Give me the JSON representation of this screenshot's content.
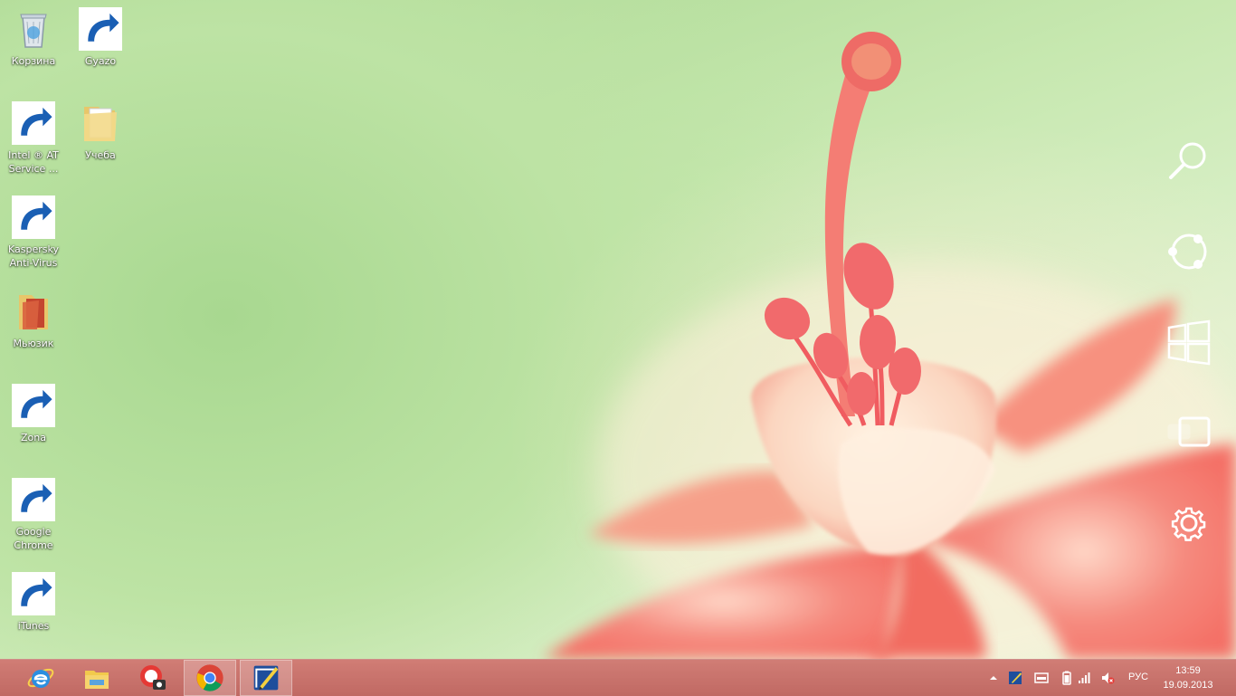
{
  "desktop": {
    "icons": [
      {
        "label": "Корзина",
        "icon": "recycle-bin-icon",
        "shortcut": false
      },
      {
        "label": "Gyazo",
        "icon": "gyazo-icon",
        "shortcut": true
      },
      {
        "label": "Intel ® AT Service ...",
        "icon": "intel-at-icon",
        "shortcut": true
      },
      {
        "label": "Учеба",
        "icon": "folder-icon",
        "shortcut": false
      },
      {
        "label": "Kaspersky Anti-Virus",
        "icon": "kaspersky-icon",
        "shortcut": true
      },
      {
        "label": "Мьюзик",
        "icon": "folder-music-icon",
        "shortcut": false
      },
      {
        "label": "Zona",
        "icon": "zona-icon",
        "shortcut": true
      },
      {
        "label": "Google Chrome",
        "icon": "chrome-icon",
        "shortcut": true
      },
      {
        "label": "iTunes",
        "icon": "itunes-icon",
        "shortcut": true
      }
    ]
  },
  "charms": [
    {
      "name": "search",
      "icon": "search-icon"
    },
    {
      "name": "share",
      "icon": "share-icon"
    },
    {
      "name": "start",
      "icon": "windows-start-icon"
    },
    {
      "name": "devices",
      "icon": "devices-icon"
    },
    {
      "name": "settings",
      "icon": "gear-icon"
    }
  ],
  "taskbar": {
    "pinned": [
      {
        "app": "Internet Explorer",
        "icon": "ie-icon",
        "active": false
      },
      {
        "app": "File Explorer",
        "icon": "file-explorer-icon",
        "active": false
      },
      {
        "app": "Gyazo screenshot",
        "icon": "screenshot-app-icon",
        "active": false
      },
      {
        "app": "Google Chrome",
        "icon": "chrome-icon",
        "active": true
      },
      {
        "app": "Gyazo",
        "icon": "gyazo-icon",
        "active": true
      }
    ],
    "tray": {
      "icons": [
        "show-hidden-icons-icon",
        "gyazo-tray-icon",
        "display-icon",
        "battery-icon",
        "network-signal-icon",
        "volume-muted-icon"
      ],
      "language": "РУС",
      "time": "13:59",
      "date": "19.09.2013"
    }
  },
  "colors": {
    "taskbar": "#c4716a",
    "wallpaper_green": "#bde3a4",
    "flower_pink": "#f07a70"
  }
}
